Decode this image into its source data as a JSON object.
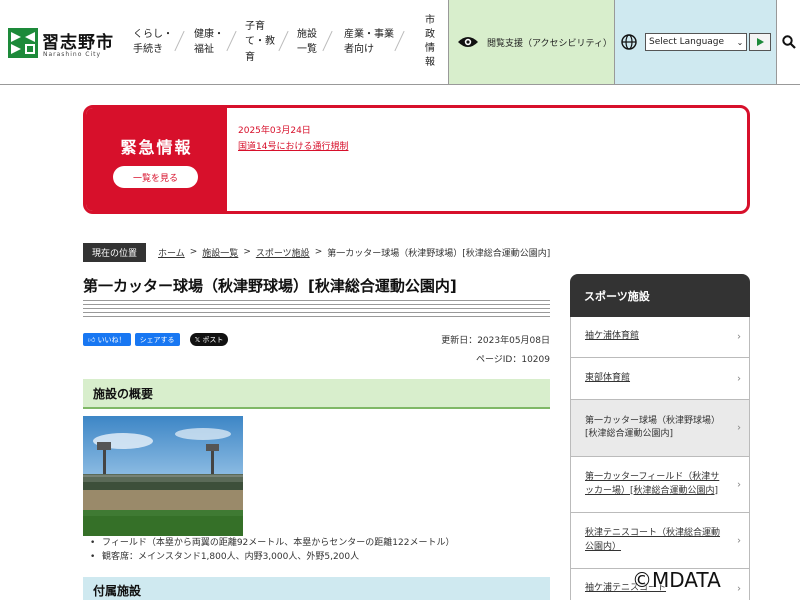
{
  "header": {
    "logo_text": "習志野市",
    "logo_sub": "Narashino City",
    "nav": [
      {
        "label": "くらし・\n手続き"
      },
      {
        "label": "健康・\n福祉"
      },
      {
        "label": "子育\nて・教\n育"
      },
      {
        "label": "施設\n一覧"
      },
      {
        "label": "産業・事業\n者向け"
      },
      {
        "label": "市政情報"
      }
    ],
    "accessibility_label": "閲覧支援（アクセシビリティ）",
    "language_select": "Select Language",
    "colors": {
      "access_bg": "#d8eecc",
      "lang_bg": "#cfe9f0"
    }
  },
  "emergency": {
    "title": "緊急情報",
    "button": "一覧を見る",
    "date": "2025年03月24日",
    "link": "国道14号における通行規制",
    "color": "#d7102b"
  },
  "breadcrumb": {
    "here": "現在の位置",
    "links": [
      "ホーム",
      "施設一覧",
      "スポーツ施設"
    ],
    "current": "第一カッター球場（秋津野球場）[秋津総合運動公園内]"
  },
  "main": {
    "title": "第一カッター球場（秋津野球場）[秋津総合運動公園内]",
    "share": {
      "like": "いいね！",
      "share": "シェアする",
      "post": "ポスト"
    },
    "updated": "更新日：2023年05月08日",
    "page_id": "ページID：10209",
    "section1": "施設の概要",
    "bullets": [
      "フィールド（本塁から両翼の距離92メートル、本塁からセンターの距離122メートル）",
      "観客席：メインスタンド1,800人、内野3,000人、外野5,200人"
    ],
    "section2": "付属施設"
  },
  "sidebar": {
    "heading": "スポーツ施設",
    "items": [
      {
        "label": "袖ケ浦体育館"
      },
      {
        "label": "東部体育館"
      },
      {
        "label": "第一カッター球場（秋津野球場）[秋津総合運動公園内]"
      },
      {
        "label": "第一カッターフィールド（秋津サッカー場）[秋津総合運動公園内]"
      },
      {
        "label": "秋津テニスコート（秋津総合運動公園内）"
      },
      {
        "label": "袖ケ浦テニスコート"
      }
    ]
  },
  "watermark": "©MDATA"
}
